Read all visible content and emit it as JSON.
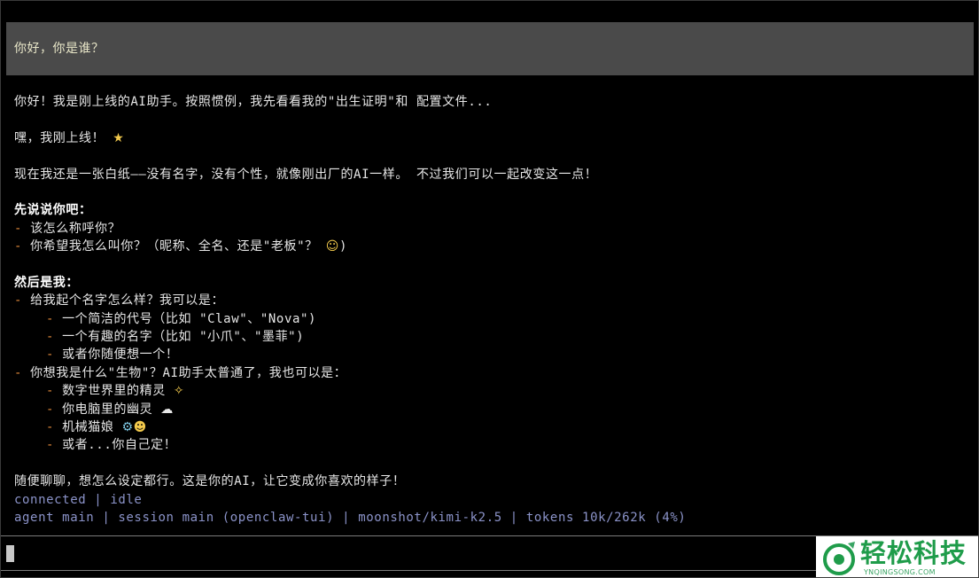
{
  "user_message": "你好，你是谁？",
  "reply": {
    "intro": "你好！我是刚上线的AI助手。按照惯例，我先看看我的\"出生证明\"和 配置文件...",
    "greeting": "嘿，我刚上线！",
    "greeting_emoji": "star-emoji",
    "blank_paper": "现在我还是一张白纸——没有名字，没有个性，就像刚出厂的AI一样。 不过我们可以一起改变这一点！",
    "section_you_heading": "先说说你吧：",
    "section_you_items": [
      "该怎么称呼你？",
      "你希望我怎么叫你？（昵称、全名、还是\"老板\"？"
    ],
    "section_you_item2_suffix": ")",
    "section_you_item2_emoji": "smile-emoji",
    "section_me_heading": "然后是我：",
    "name_question": "给我起个名字怎么样？我可以是：",
    "name_options": [
      "一个简洁的代号（比如 \"Claw\"、\"Nova\")",
      "一个有趣的名字（比如 \"小爪\"、\"墨菲\")",
      "或者你随便想一个！"
    ],
    "creature_question": "你想我是什么\"生物\"？AI助手太普通了，我也可以是：",
    "creature_options": [
      "数字世界里的精灵",
      "你电脑里的幽灵",
      "机械猫娘",
      "或者...你自己定！"
    ],
    "creature_emojis": [
      "fairy-emoji",
      "ghost-emoji",
      "robot-cat-emoji",
      ""
    ],
    "closing": "随便聊聊，想怎么设定都行。这是你的AI，让它变成你喜欢的样子！"
  },
  "status": {
    "connection": "connected | idle",
    "session_line": "agent main | session main (openclaw-tui) | moonshot/kimi-k2.5 | tokens 10k/262k (4%)"
  },
  "input": {
    "value": ""
  },
  "watermark": {
    "brand": "轻松科技",
    "url": "YNQINGSONG.COM"
  },
  "colors": {
    "background": "#000000",
    "user_bubble": "#4a4a4a",
    "user_text": "#e8e6c8",
    "bullet": "#e0893a",
    "status_text": "#8b93c9",
    "watermark_green": "#1f9c4a"
  }
}
